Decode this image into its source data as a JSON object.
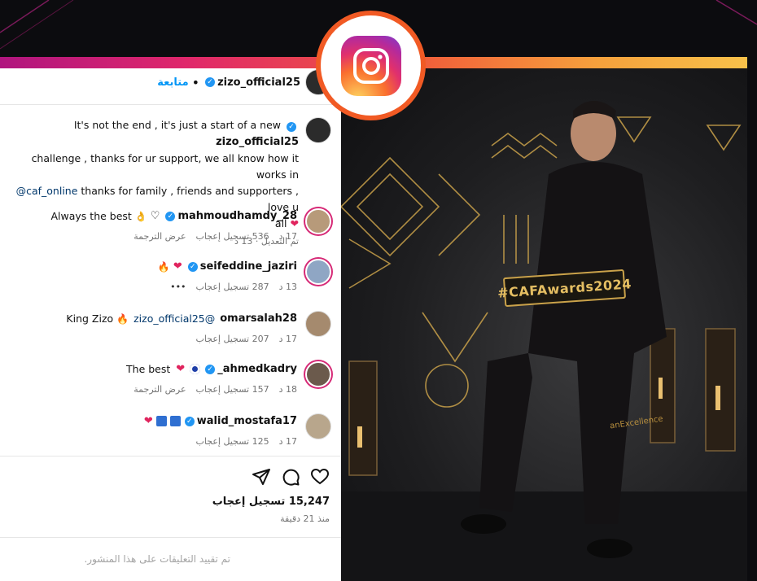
{
  "badge": {
    "icon": "instagram-icon"
  },
  "post": {
    "author": "zizo_official25",
    "follow_label": "متابعة",
    "separator": "•",
    "caption_author": "zizo_official25",
    "caption_lines": [
      "It's not the end , it's just a start of a new",
      "challenge , thanks for ur support, we all know how it works in",
      "thanks for family , friends and supporters , love u",
      "all"
    ],
    "caption_mention": "@caf_online",
    "caption_meta": "تم التعديل · 13 د",
    "likes": "15,247 تسجيل إعجاب",
    "time_ago": "منذ 21 دقيقة",
    "comments_restricted": "تم تقييد التعليقات على هذا المنشور."
  },
  "comments": [
    {
      "user": "mahmoudhamdy_28",
      "text": "Always the best",
      "age": "17 د",
      "likes": "536 تسجيل إعجاب",
      "action": "عرض الترجمة"
    },
    {
      "user": "seifeddine_jaziri",
      "text": "",
      "age": "13 د",
      "likes": "287 تسجيل إعجاب",
      "action": "•••"
    },
    {
      "user": "omarsalah28",
      "text": "King Zizo",
      "mention": "@zizo_official25",
      "age": "17 د",
      "likes": "207 تسجيل إعجاب",
      "action": ""
    },
    {
      "user": "ahmedkadry_",
      "text": "The best",
      "age": "18 د",
      "likes": "157 تسجيل إعجاب",
      "action": "عرض الترجمة"
    },
    {
      "user": "walid_mostafa17",
      "text": "",
      "age": "17 د",
      "likes": "125 تسجيل إعجاب",
      "action": ""
    }
  ],
  "photo": {
    "board_text": "#CAFAwards2024",
    "wall_text": "anExcellence"
  },
  "colors": {
    "badge_ring": "#f15a24",
    "verified": "#2196f3",
    "link": "#00376b",
    "follow": "#0095f6"
  }
}
